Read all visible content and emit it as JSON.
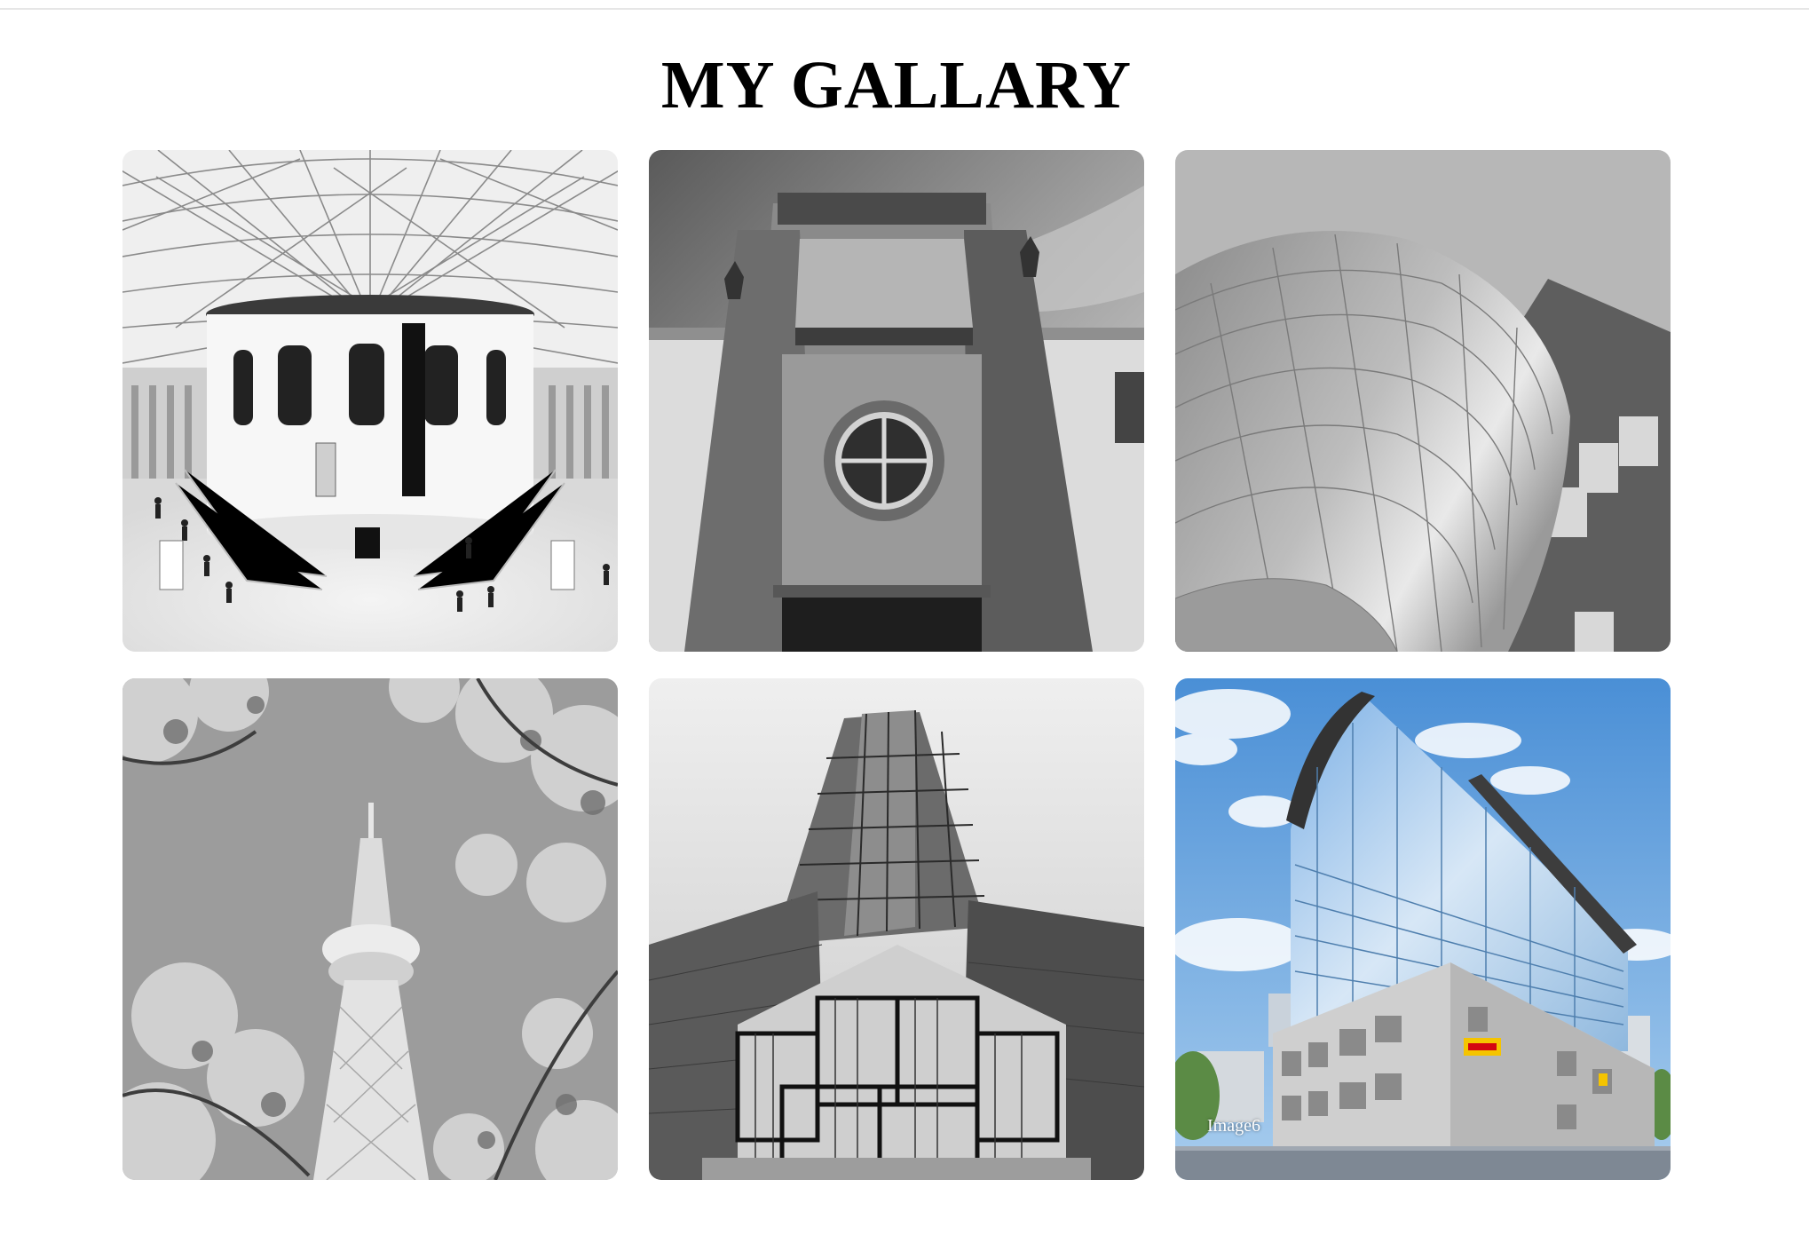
{
  "page": {
    "title": "MY GALLARY",
    "background": "#ffffff"
  },
  "gallery": {
    "items": [
      {
        "name": "gallery-image-1",
        "subject": "museum-great-court-dome",
        "caption": ""
      },
      {
        "name": "gallery-image-2",
        "subject": "stone-portal-round-window",
        "caption": ""
      },
      {
        "name": "gallery-image-3",
        "subject": "curved-metal-facade",
        "caption": ""
      },
      {
        "name": "gallery-image-4",
        "subject": "tv-tower-through-blossoms",
        "caption": ""
      },
      {
        "name": "gallery-image-5",
        "subject": "glass-skyscraper",
        "caption": ""
      },
      {
        "name": "gallery-image-6",
        "subject": "dhl-office-building",
        "caption": "Image6"
      }
    ]
  },
  "colors": {
    "sky_blue": "#5d9ddc",
    "dhl_yellow": "#f5c400",
    "dhl_red": "#d40511"
  }
}
